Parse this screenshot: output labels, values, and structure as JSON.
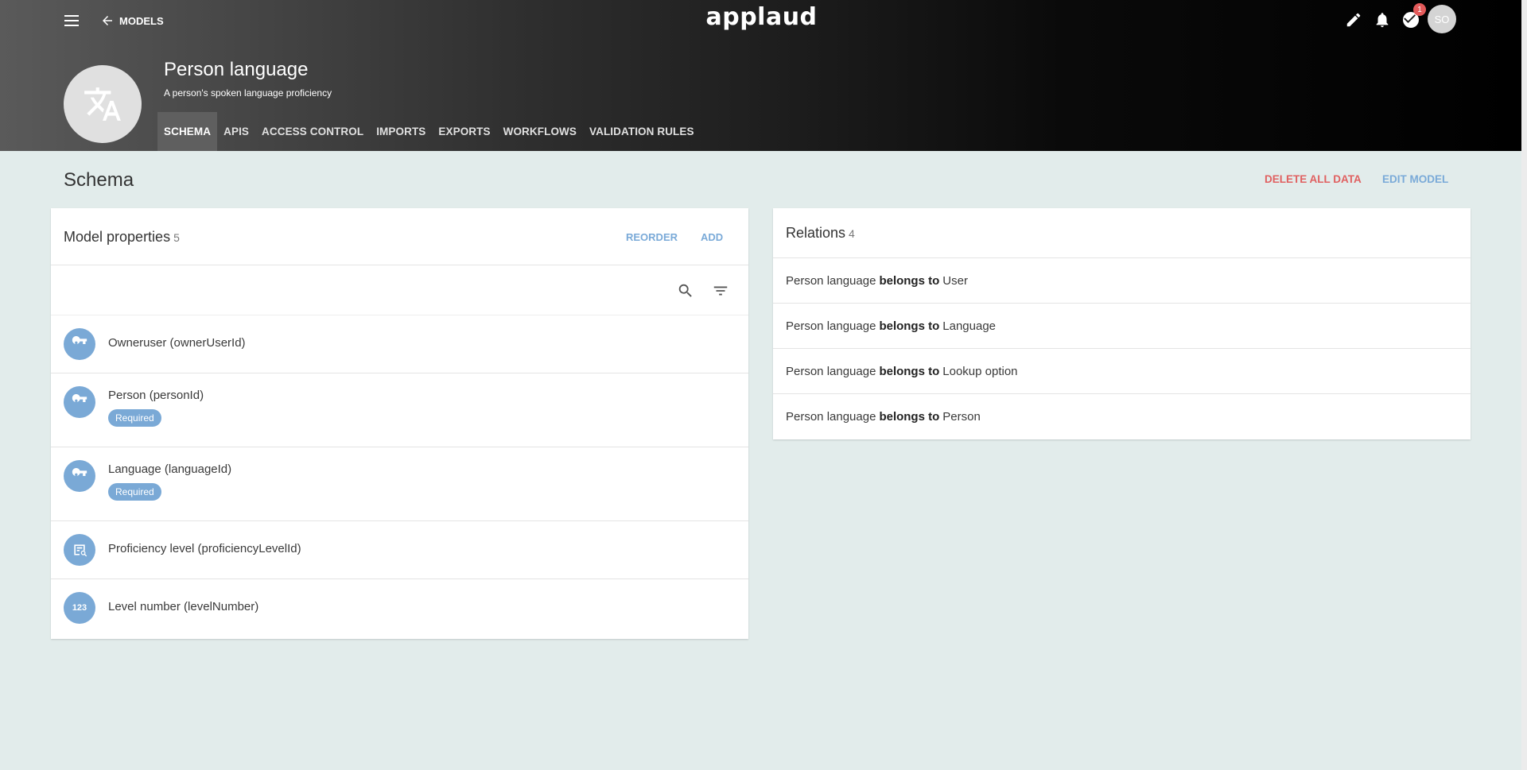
{
  "header": {
    "back_label": "MODELS",
    "logo_text": "applaud",
    "notification_count": "1",
    "user_initials": "SO"
  },
  "model": {
    "title": "Person language",
    "description": "A person's spoken language proficiency",
    "icon": "translate-icon"
  },
  "tabs": [
    {
      "label": "SCHEMA",
      "active": true
    },
    {
      "label": "APIS"
    },
    {
      "label": "ACCESS CONTROL"
    },
    {
      "label": "IMPORTS"
    },
    {
      "label": "EXPORTS"
    },
    {
      "label": "WORKFLOWS"
    },
    {
      "label": "VALIDATION RULES"
    }
  ],
  "page": {
    "title": "Schema",
    "delete_all_label": "DELETE ALL DATA",
    "edit_model_label": "EDIT MODEL"
  },
  "properties": {
    "title": "Model properties",
    "count": "5",
    "reorder_label": "REORDER",
    "add_label": "ADD",
    "items": [
      {
        "name": "Owneruser (ownerUserId)",
        "icon": "key-icon"
      },
      {
        "name": "Person (personId)",
        "icon": "key-icon",
        "badge": "Required"
      },
      {
        "name": "Language (languageId)",
        "icon": "key-icon",
        "badge": "Required"
      },
      {
        "name": "Proficiency level (proficiencyLevelId)",
        "icon": "lookup-icon"
      },
      {
        "name": "Level number (levelNumber)",
        "icon": "number-icon",
        "icon_text": "123"
      }
    ]
  },
  "relations": {
    "title": "Relations",
    "count": "4",
    "items": [
      {
        "subject": "Person language",
        "verb": "belongs to",
        "target": "User"
      },
      {
        "subject": "Person language",
        "verb": "belongs to",
        "target": "Language"
      },
      {
        "subject": "Person language",
        "verb": "belongs to",
        "target": "Lookup option"
      },
      {
        "subject": "Person language",
        "verb": "belongs to",
        "target": "Person"
      }
    ]
  },
  "colors": {
    "accent": "#7aa9d6",
    "danger": "#e06060",
    "badge": "#e35a5a",
    "page_bg": "#e2eceb"
  }
}
